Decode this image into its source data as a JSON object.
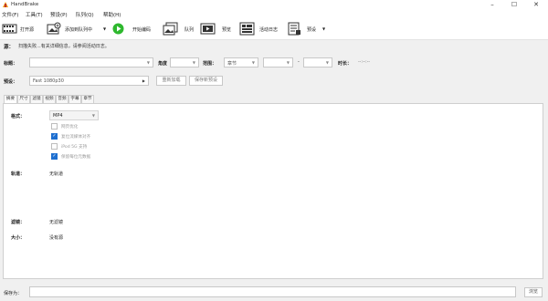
{
  "window": {
    "title": "HandBrake",
    "minimize": "–",
    "maximize": "☐",
    "close": "✕"
  },
  "menu": {
    "items": [
      "文件(F)",
      "工具(T)",
      "预设(P)",
      "队列(Q)",
      "帮助(H)"
    ]
  },
  "toolbar": {
    "open_source": "打开源",
    "add_to_queue": "添加到队列中",
    "start_encode": "开始编码",
    "queue": "队列",
    "preview": "预览",
    "activity_log": "活动日志",
    "presets": "预设"
  },
  "source": {
    "label": "源：",
    "text": "扫描失败...有关详细信息，请参阅活动日志。"
  },
  "title_row": {
    "title_label": "标题：",
    "angle_label": "角度",
    "range_label": "范围：",
    "range_value": "章节",
    "range_sep": "-",
    "duration_label": "时长：",
    "duration_value": "--:--:--"
  },
  "preset_row": {
    "label": "预设：",
    "value": "Fast 1080p30",
    "reload_button": "重新加载",
    "save_button": "保存新预设"
  },
  "tabs": [
    "摘要",
    "尺寸",
    "滤镜",
    "视频",
    "音频",
    "字幕",
    "章节"
  ],
  "summary": {
    "format_label": "格式：",
    "format_value": "MP4",
    "options": [
      {
        "label": "网页优化",
        "checked": false
      },
      {
        "label": "复位流媒体对齐",
        "checked": true
      },
      {
        "label": "iPod 5G 支持",
        "checked": false
      },
      {
        "label": "保留每位元数据",
        "checked": true
      }
    ],
    "tracks_label": "轨道：",
    "tracks_value": "无轨道",
    "filters_label": "滤镜：",
    "filters_value": "无滤镜",
    "size_label": "大小：",
    "size_value": "没有源"
  },
  "saveas": {
    "label": "保存为：",
    "browse_button": "浏览"
  }
}
